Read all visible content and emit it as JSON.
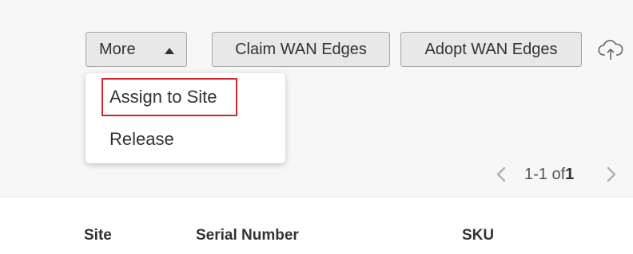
{
  "toolbar": {
    "more_label": "More",
    "claim_label": "Claim WAN Edges",
    "adopt_label": "Adopt WAN Edges"
  },
  "more_menu": {
    "items": [
      {
        "label": "Assign to Site",
        "highlighted": true
      },
      {
        "label": "Release"
      }
    ]
  },
  "pagination": {
    "range": "1-1 of ",
    "total": "1"
  },
  "table": {
    "columns": [
      "Site",
      "Serial Number",
      "SKU"
    ]
  },
  "colors": {
    "highlight": "#d22630",
    "button_bg": "#e8e8e8",
    "panel_bg": "#f7f7f7"
  },
  "icons": {
    "more_caret": "caret-up-icon",
    "upload": "cloud-upload-icon",
    "prev": "chevron-left-icon",
    "next": "chevron-right-icon"
  }
}
